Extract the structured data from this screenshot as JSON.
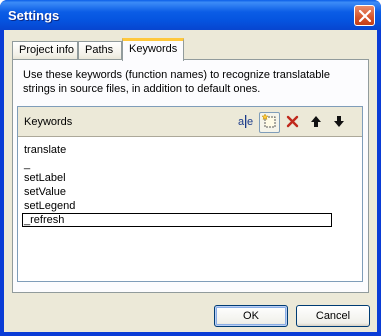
{
  "window": {
    "title": "Settings"
  },
  "tabs": [
    {
      "label": "Project info",
      "active": false
    },
    {
      "label": "Paths",
      "active": false
    },
    {
      "label": "Keywords",
      "active": true
    }
  ],
  "description": "Use these keywords (function names) to recognize translatable strings in source files, in addition to default ones.",
  "keywords_panel": {
    "title": "Keywords",
    "toolbar": [
      "edit-text-icon",
      "new-item-icon",
      "delete-icon",
      "move-up-icon",
      "move-down-icon"
    ],
    "items": [
      "translate",
      "_",
      "setLabel",
      "setValue",
      "setLegend",
      "_refresh"
    ],
    "editing_index": 5
  },
  "buttons": {
    "ok": "OK",
    "cancel": "Cancel"
  },
  "colors": {
    "title_bar": "#0553df",
    "face": "#ece9d8",
    "active_tab_accent": "#ffc83c",
    "delete_red": "#c0281c"
  }
}
